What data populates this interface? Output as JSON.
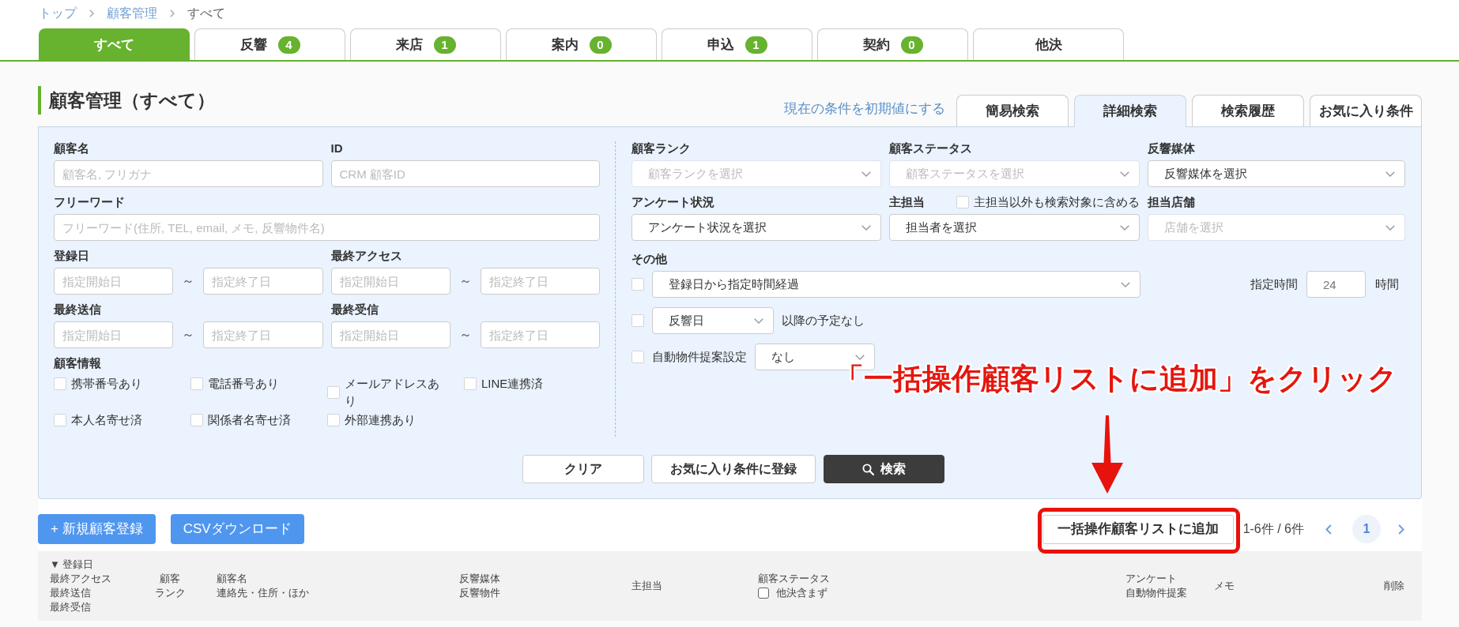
{
  "breadcrumb": [
    {
      "label": "トップ",
      "link": true
    },
    {
      "label": "顧客管理",
      "link": true
    },
    {
      "label": "すべて",
      "link": false
    }
  ],
  "status_tabs": [
    {
      "label": "すべて",
      "selected": true
    },
    {
      "label": "反響",
      "count": "4",
      "selected": false
    },
    {
      "label": "来店",
      "count": "1",
      "selected": false
    },
    {
      "label": "案内",
      "count": "0",
      "selected": false
    },
    {
      "label": "申込",
      "count": "1",
      "selected": false
    },
    {
      "label": "契約",
      "count": "0",
      "selected": false
    },
    {
      "label": "他決",
      "selected": false
    }
  ],
  "page_title": "顧客管理（すべて）",
  "search_header": {
    "reset_link": "現在の条件を初期値にする",
    "tabs": [
      {
        "label": "簡易検索",
        "selected": false
      },
      {
        "label": "詳細検索",
        "selected": true
      },
      {
        "label": "検索履歴",
        "selected": false
      },
      {
        "label": "お気に入り条件",
        "selected": false
      }
    ]
  },
  "search_form": {
    "text_fields": [
      {
        "label": "顧客名",
        "placeholder": "顧客名, フリガナ"
      },
      {
        "label": "ID",
        "placeholder": "CRM 顧客ID"
      },
      {
        "label": "フリーワード",
        "placeholder": "フリーワード(住所, TEL, email, メモ, 反響物件名)"
      }
    ],
    "date_ranges": [
      {
        "label": "登録日",
        "from_placeholder": "指定開始日",
        "separator": "～",
        "to_placeholder": "指定終了日"
      },
      {
        "label": "最終アクセス",
        "from_placeholder": "指定開始日",
        "separator": "～",
        "to_placeholder": "指定終了日"
      },
      {
        "label": "最終送信",
        "from_placeholder": "指定開始日",
        "separator": "～",
        "to_placeholder": "指定終了日"
      },
      {
        "label": "最終受信",
        "from_placeholder": "指定開始日",
        "separator": "～",
        "to_placeholder": "指定終了日"
      }
    ],
    "customer_info": {
      "label": "顧客情報",
      "options": [
        {
          "label": "携帯番号あり",
          "checked": false
        },
        {
          "label": "電話番号あり",
          "checked": false
        },
        {
          "label": "メールアドレスあり",
          "checked": false
        },
        {
          "label": "LINE連携済",
          "checked": false
        },
        {
          "label": "本人名寄せ済",
          "checked": false
        },
        {
          "label": "関係者名寄せ済",
          "checked": false
        },
        {
          "label": "外部連携あり",
          "checked": false
        }
      ]
    },
    "selects": [
      {
        "label": "顧客ランク",
        "placeholder": "顧客ランクを選択"
      },
      {
        "label": "顧客ステータス",
        "placeholder": "顧客ステータスを選択"
      },
      {
        "label": "反響媒体",
        "value": "反響媒体を選択"
      },
      {
        "label": "アンケート状況",
        "value": "アンケート状況を選択"
      },
      {
        "label": "主担当",
        "value": "担当者を選択",
        "option": {
          "label": "主担当以外も検索対象に含める",
          "checked": false
        }
      },
      {
        "label": "担当店舗",
        "placeholder": "店舗を選択"
      }
    ],
    "other_conditions": {
      "label": "その他",
      "rows": [
        {
          "kind": "elapsed",
          "checked": false,
          "select": "登録日から指定時間経過",
          "hours_label": "指定時間",
          "hours_value": "24",
          "hours_unit": "時間"
        },
        {
          "kind": "no_schedule",
          "checked": false,
          "select": "反響日",
          "suffix": "以降の予定なし"
        },
        {
          "kind": "auto_proposal",
          "checked": false,
          "label": "自動物件提案設定",
          "select": "なし"
        }
      ]
    },
    "buttons": [
      {
        "label": "クリア",
        "kind": "default"
      },
      {
        "label": "お気に入り条件に登録",
        "kind": "default"
      },
      {
        "label": "検索",
        "kind": "search"
      }
    ]
  },
  "annotation": {
    "text": "「一括操作顧客リストに追加」をクリック"
  },
  "toolbar": {
    "left_buttons": [
      {
        "label": "+ 新規顧客登録"
      },
      {
        "label": "CSVダウンロード"
      }
    ],
    "bulk_button": {
      "label": "一括操作顧客リストに追加",
      "highlighted": true
    },
    "range": "1-6件 / 6件",
    "pages": [
      {
        "label": "1",
        "selected": true
      }
    ]
  },
  "table": {
    "columns": [
      {
        "lines": [
          "▼ 登録日",
          "最終アクセス",
          "最終送信",
          "最終受信"
        ]
      },
      {
        "lines": [
          "顧客",
          "ランク"
        ]
      },
      {
        "lines": [
          "顧客名",
          "連絡先・住所・ほか"
        ]
      },
      {
        "lines": [
          "反響媒体",
          "反響物件"
        ]
      },
      {
        "lines": [
          "主担当"
        ]
      },
      {
        "lines": [
          "顧客ステータス"
        ],
        "option": {
          "label": "他決含まず",
          "checked": false
        }
      },
      {
        "lines": [
          "アンケート",
          "自動物件提案"
        ]
      },
      {
        "lines": [
          "メモ"
        ]
      },
      {
        "lines": [
          "削除"
        ]
      }
    ]
  }
}
